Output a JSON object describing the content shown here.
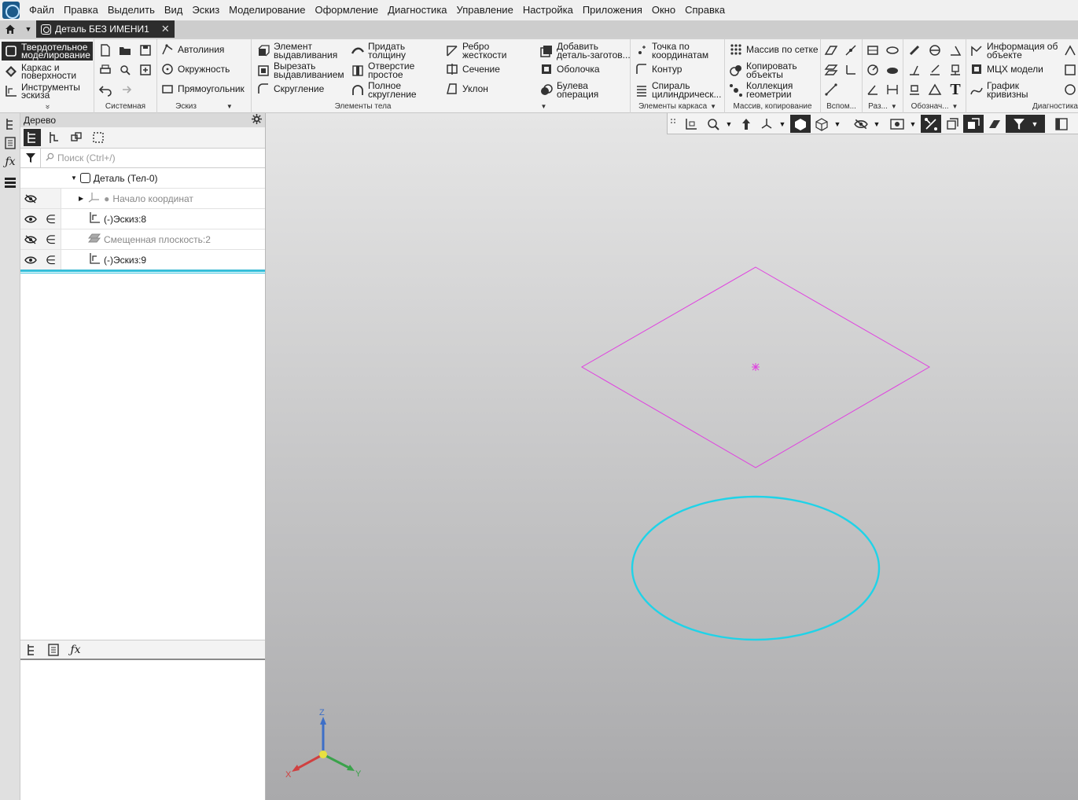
{
  "menu": [
    "Файл",
    "Правка",
    "Выделить",
    "Вид",
    "Эскиз",
    "Моделирование",
    "Оформление",
    "Диагностика",
    "Управление",
    "Настройка",
    "Приложения",
    "Окно",
    "Справка"
  ],
  "tab": {
    "title": "Деталь БЕЗ ИМЕНИ1",
    "close": "✕"
  },
  "ribbon": {
    "modes": {
      "solid": "Твердотельное моделирование",
      "frame": "Каркас и поверхности",
      "sketch_tools": "Инструменты эскиза",
      "more": "»"
    },
    "groups": {
      "system": "Системная",
      "sketch": "Эскиз",
      "body": "Элементы тела",
      "frame": "Элементы каркаса",
      "array": "Массив, копирование",
      "aux": "Вспом...",
      "dim": "Раз...",
      "desig": "Обознач...",
      "diag": "Диагностика"
    },
    "sketch": {
      "autoline": "Автолиния",
      "circle": "Окружность",
      "rect": "Прямоугольник"
    },
    "body": {
      "extrude": "Элемент выдавливания",
      "cut_extrude": "Вырезать выдавливанием",
      "fillet": "Скругление",
      "thicken": "Придать толщину",
      "hole": "Отверстие простое",
      "full_round": "Полное скругление",
      "rib": "Ребро жесткости",
      "section": "Сечение",
      "draft": "Уклон",
      "add_part": "Добавить деталь-заготов...",
      "shell": "Оболочка",
      "boolean": "Булева операция"
    },
    "frame": {
      "point": "Точка по координатам",
      "contour": "Контур",
      "spiral": "Спираль цилиндрическ..."
    },
    "array": {
      "grid": "Массив по сетке",
      "copy": "Копировать объекты",
      "collection": "Коллекция геометрии"
    },
    "diag": {
      "info": "Информация об объекте",
      "mcx": "МЦХ модели",
      "curvature": "График кривизны"
    }
  },
  "tree": {
    "title": "Дерево",
    "search_placeholder": "Поиск (Ctrl+/)",
    "root": "Деталь (Тел-0)",
    "items": [
      {
        "label": "Начало координат"
      },
      {
        "label": "(-)Эскиз:8"
      },
      {
        "label": "Смещенная плоскость:2"
      },
      {
        "label": "(-)Эскиз:9"
      }
    ]
  },
  "axes": {
    "x": "X",
    "y": "Y",
    "z": "Z"
  },
  "colors": {
    "plane": "#e040e0",
    "circle": "#1fd3e8",
    "accent": "#2b2b2b"
  }
}
